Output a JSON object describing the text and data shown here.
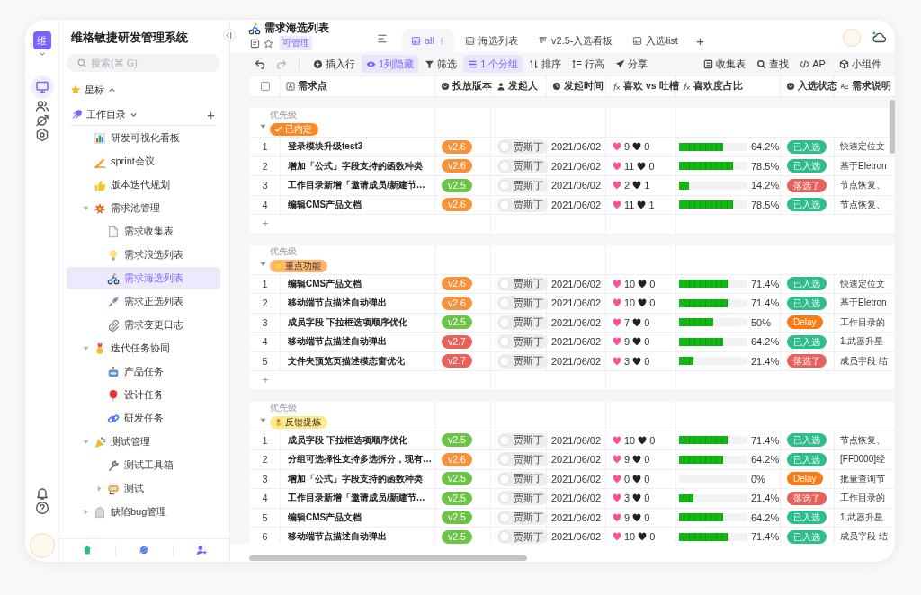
{
  "app": {
    "logo": "维"
  },
  "sidebar": {
    "title": "维格敏捷研发管理系统",
    "search": {
      "placeholder": "搜索(⌘ G)"
    },
    "starred": {
      "label": "星标",
      "expanded": false
    },
    "workspace": {
      "label": "工作目录",
      "expanded": true,
      "add": "+",
      "children": [
        {
          "label": "研发可视化看板",
          "selected": false
        },
        {
          "label": "sprint会议",
          "selected": false
        },
        {
          "label": "版本迭代规划",
          "selected": false
        },
        {
          "label": "需求池管理",
          "selected": false,
          "expanded": true,
          "children": [
            {
              "label": "需求收集表",
              "selected": false
            },
            {
              "label": "需求浪选列表",
              "selected": false
            },
            {
              "label": "需求海选列表",
              "selected": true
            },
            {
              "label": "需求正选列表",
              "selected": false
            },
            {
              "label": "需求变更日志",
              "selected": false
            }
          ]
        },
        {
          "label": "迭代任务协同",
          "selected": false,
          "expanded": true,
          "children": [
            {
              "label": "产品任务",
              "selected": false
            },
            {
              "label": "设计任务",
              "selected": false
            },
            {
              "label": "研发任务",
              "selected": false
            }
          ]
        },
        {
          "label": "测试管理",
          "selected": false,
          "expanded": true,
          "children": [
            {
              "label": "测试工具箱",
              "selected": false
            },
            {
              "label": "测试",
              "selected": false,
              "expanded": false
            }
          ]
        },
        {
          "label": "缺陷bug管理",
          "selected": false,
          "expanded": false
        }
      ]
    }
  },
  "header": {
    "title": "需求海选列表",
    "permission": "可管理",
    "tabs": [
      {
        "label": "all",
        "kind": "grid",
        "selected": true
      },
      {
        "label": "海选列表",
        "kind": "grid",
        "selected": false
      },
      {
        "label": "v2.5-入选看板",
        "kind": "kanban",
        "selected": false
      },
      {
        "label": "入选list",
        "kind": "grid",
        "selected": false
      }
    ],
    "add_tab": "+"
  },
  "toolbar": {
    "left": [
      {
        "label": "插入行",
        "kind": "insert",
        "active": false
      },
      {
        "label": "1列隐藏",
        "kind": "hide",
        "active": true
      },
      {
        "label": "筛选",
        "kind": "filter",
        "active": false
      },
      {
        "label": "1 个分组",
        "kind": "group",
        "active": true
      },
      {
        "label": "排序",
        "kind": "sort",
        "active": false
      },
      {
        "label": "行高",
        "kind": "height",
        "active": false
      },
      {
        "label": "分享",
        "kind": "share",
        "active": false
      }
    ],
    "right": [
      {
        "label": "收集表",
        "kind": "form",
        "active": false
      },
      {
        "label": "查找",
        "kind": "search",
        "active": false
      },
      {
        "label": "API",
        "kind": "api",
        "active": false
      },
      {
        "label": "小组件",
        "kind": "widget",
        "active": false
      }
    ]
  },
  "table": {
    "select_all": {
      "checked": false
    },
    "columns": [
      {
        "label": "需求点",
        "kind": "text"
      },
      {
        "label": "投放版本",
        "kind": "select"
      },
      {
        "label": "发起人",
        "kind": "member"
      },
      {
        "label": "发起时间",
        "kind": "date"
      },
      {
        "label": "喜欢 vs 吐槽",
        "kind": "formula"
      },
      {
        "label": "喜欢度占比",
        "kind": "formula"
      },
      {
        "label": "入选状态",
        "kind": "select"
      },
      {
        "label": "需求说明",
        "kind": "longtext"
      }
    ],
    "groups": [
      {
        "field": "优先级",
        "expanded": true,
        "tag": {
          "label": "已内定",
          "kind": "check",
          "color": "#fa8a25"
        },
        "add_row": "+",
        "rows": [
          {
            "index": "1",
            "title": "登录模块升级test3",
            "version": {
              "label": "v2.6",
              "color": "#f8913b"
            },
            "owner": "贾斯丁",
            "date": "2021/06/02",
            "likes": "9",
            "dislikes": "0",
            "ratio": {
              "level": 0.642,
              "label": "64.2%"
            },
            "status": {
              "label": "已入选",
              "color": "#2ebd8d"
            },
            "note": "快速定位文"
          },
          {
            "index": "2",
            "title": "增加「公式」字段支持的函数种类",
            "version": {
              "label": "v2.6",
              "color": "#f8913b"
            },
            "owner": "贾斯丁",
            "date": "2021/06/02",
            "likes": "11",
            "dislikes": "0",
            "ratio": {
              "level": 0.785,
              "label": "78.5%"
            },
            "status": {
              "label": "已入选",
              "color": "#2ebd8d"
            },
            "note": "基于Eletron"
          },
          {
            "index": "3",
            "title": "工作目录新增「邀请成员/新建节…",
            "version": {
              "label": "v2.5",
              "color": "#6cc447"
            },
            "owner": "贾斯丁",
            "date": "2021/06/02",
            "likes": "2",
            "dislikes": "1",
            "ratio": {
              "level": 0.142,
              "label": "14.2%"
            },
            "status": {
              "label": "落选了",
              "color": "#e8615b"
            },
            "note": "节点恢复、"
          },
          {
            "index": "4",
            "title": "编辑CMS产品文档",
            "version": {
              "label": "v2.6",
              "color": "#f8913b"
            },
            "owner": "贾斯丁",
            "date": "2021/06/02",
            "likes": "11",
            "dislikes": "1",
            "ratio": {
              "level": 0.785,
              "label": "78.5%"
            },
            "status": {
              "label": "已入选",
              "color": "#2ebd8d"
            },
            "note": "节点恢复、"
          }
        ]
      },
      {
        "field": "优先级",
        "expanded": true,
        "tag": {
          "label": "重点功能",
          "kind": "face",
          "color": "#ffb673"
        },
        "add_row": "+",
        "rows": [
          {
            "index": "1",
            "title": "编辑CMS产品文档",
            "version": {
              "label": "v2.6",
              "color": "#f8913b"
            },
            "owner": "贾斯丁",
            "date": "2021/06/02",
            "likes": "10",
            "dislikes": "0",
            "ratio": {
              "level": 0.714,
              "label": "71.4%"
            },
            "status": {
              "label": "已入选",
              "color": "#2ebd8d"
            },
            "note": "快速定位文"
          },
          {
            "index": "2",
            "title": "移动端节点描述自动弹出",
            "version": {
              "label": "v2.6",
              "color": "#f8913b"
            },
            "owner": "贾斯丁",
            "date": "2021/06/02",
            "likes": "10",
            "dislikes": "0",
            "ratio": {
              "level": 0.714,
              "label": "71.4%"
            },
            "status": {
              "label": "已入选",
              "color": "#2ebd8d"
            },
            "note": "基于Eletron"
          },
          {
            "index": "3",
            "title": "成员字段 下拉框选项顺序优化",
            "version": {
              "label": "v2.5",
              "color": "#6cc447"
            },
            "owner": "贾斯丁",
            "date": "2021/06/02",
            "likes": "7",
            "dislikes": "0",
            "ratio": {
              "level": 0.5,
              "label": "50%"
            },
            "status": {
              "label": "Delay",
              "color": "#fa7a15"
            },
            "note": "工作目录的"
          },
          {
            "index": "4",
            "title": "移动端节点描述自动弹出",
            "version": {
              "label": "v2.7",
              "color": "#e8615b"
            },
            "owner": "贾斯丁",
            "date": "2021/06/02",
            "likes": "9",
            "dislikes": "0",
            "ratio": {
              "level": 0.642,
              "label": "64.2%"
            },
            "status": {
              "label": "已入选",
              "color": "#2ebd8d"
            },
            "note": "1.武器升星"
          },
          {
            "index": "5",
            "title": "文件夹预览页描述模态窗优化",
            "version": {
              "label": "v2.7",
              "color": "#e8615b"
            },
            "owner": "贾斯丁",
            "date": "2021/06/02",
            "likes": "3",
            "dislikes": "0",
            "ratio": {
              "level": 0.214,
              "label": "21.4%"
            },
            "status": {
              "label": "落选了",
              "color": "#e8615b"
            },
            "note": "成员字段 结"
          }
        ]
      },
      {
        "field": "优先级",
        "expanded": true,
        "tag": {
          "label": "反馈提炼",
          "kind": "medal",
          "color": "#ffe98a"
        },
        "rows": [
          {
            "index": "1",
            "title": "成员字段 下拉框选项顺序优化",
            "version": {
              "label": "v2.5",
              "color": "#6cc447"
            },
            "owner": "贾斯丁",
            "date": "2021/06/02",
            "likes": "10",
            "dislikes": "0",
            "ratio": {
              "level": 0.714,
              "label": "71.4%"
            },
            "status": {
              "label": "已入选",
              "color": "#2ebd8d"
            },
            "note": "节点恢复、"
          },
          {
            "index": "2",
            "title": "分组可选择性支持多选拆分，现有…",
            "version": {
              "label": "v2.6",
              "color": "#f8913b"
            },
            "owner": "贾斯丁",
            "date": "2021/06/02",
            "likes": "9",
            "dislikes": "0",
            "ratio": {
              "level": 0.642,
              "label": "64.2%"
            },
            "status": {
              "label": "已入选",
              "color": "#2ebd8d"
            },
            "note": "[FF0000]经"
          },
          {
            "index": "3",
            "title": "增加「公式」字段支持的函数种类",
            "version": {
              "label": "v2.5",
              "color": "#6cc447"
            },
            "owner": "贾斯丁",
            "date": "2021/06/02",
            "likes": "0",
            "dislikes": "0",
            "ratio": {
              "level": 0,
              "label": "0%"
            },
            "status": {
              "label": "Delay",
              "color": "#fa7a15"
            },
            "note": "批量查询节"
          },
          {
            "index": "4",
            "title": "工作目录新增「邀请成员/新建节…",
            "version": {
              "label": "v2.5",
              "color": "#6cc447"
            },
            "owner": "贾斯丁",
            "date": "2021/06/02",
            "likes": "3",
            "dislikes": "0",
            "ratio": {
              "level": 0.214,
              "label": "21.4%"
            },
            "status": {
              "label": "落选了",
              "color": "#e8615b"
            },
            "note": "工作目录的"
          },
          {
            "index": "5",
            "title": "编辑CMS产品文档",
            "version": {
              "label": "v2.5",
              "color": "#6cc447"
            },
            "owner": "贾斯丁",
            "date": "2021/06/02",
            "likes": "9",
            "dislikes": "0",
            "ratio": {
              "level": 0.642,
              "label": "64.2%"
            },
            "status": {
              "label": "已入选",
              "color": "#2ebd8d"
            },
            "note": "1.武器升星"
          },
          {
            "index": "6",
            "title": "移动端节点描述自动弹出",
            "version": {
              "label": "v2.5",
              "color": "#6cc447"
            },
            "owner": "贾斯丁",
            "date": "2021/06/02",
            "likes": "10",
            "dislikes": "0",
            "ratio": {
              "level": 0.714,
              "label": "71.4%"
            },
            "status": {
              "label": "已入选",
              "color": "#2ebd8d"
            },
            "note": "成员字段 结"
          }
        ]
      }
    ]
  }
}
